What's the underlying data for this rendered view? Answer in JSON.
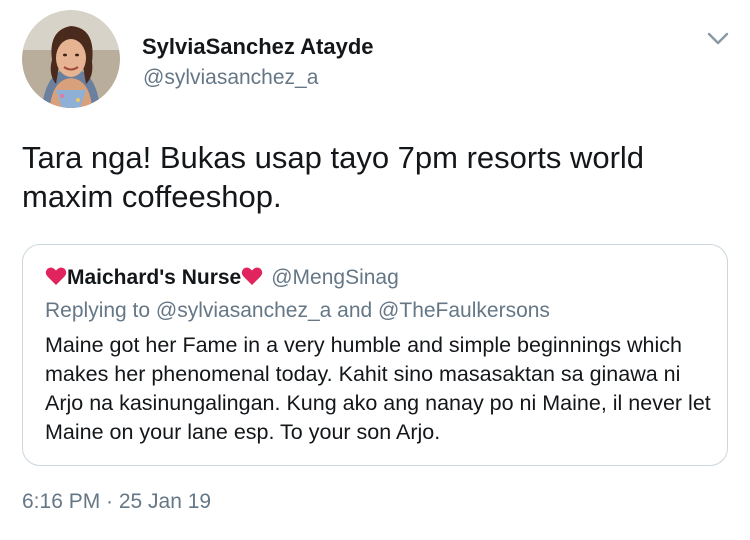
{
  "author": {
    "display_name": "SylviaSanchez Atayde",
    "handle": "@sylviasanchez_a"
  },
  "tweet": {
    "text": "Tara nga! Bukas usap tayo 7pm resorts world maxim coffeeshop.",
    "timestamp": "6:16 PM · 25 Jan 19"
  },
  "quoted_tweet": {
    "display_name": "Maichard's Nurse",
    "handle": "@MengSinag",
    "replying_prefix": "Replying to",
    "replying_to_1": "@sylviasanchez_a",
    "replying_and": "and",
    "replying_to_2": "@TheFaulkersons",
    "text": "Maine got her Fame in a very humble and simple beginnings which makes her phenomenal today. Kahit sino masasaktan sa ginawa ni Arjo na kasinungalingan. Kung ako ang nanay po ni Maine, il never let Maine on your lane esp. To your son Arjo."
  },
  "icons": {
    "menu": "chevron-down-icon",
    "emoji": "red-heart-icon"
  },
  "colors": {
    "primary_text": "#14171a",
    "secondary_text": "#657786",
    "border": "#ccd6dd",
    "heart": "#e0245e"
  }
}
